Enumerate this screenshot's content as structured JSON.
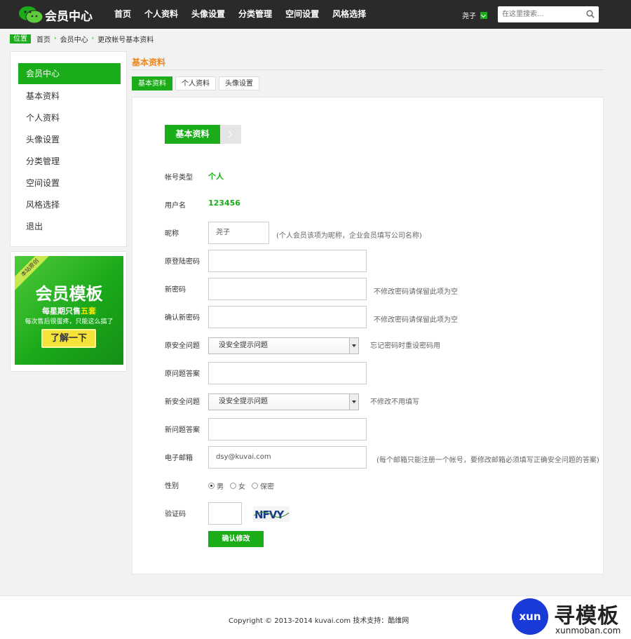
{
  "header": {
    "logo_text": "会员中心",
    "nav": [
      "首页",
      "个人资料",
      "头像设置",
      "分类管理",
      "空间设置",
      "风格选择"
    ],
    "username": "尧子",
    "search_placeholder": "在这里搜索..."
  },
  "breadcrumb": {
    "label": "位置",
    "items": [
      "首页",
      "会员中心",
      "更改帐号基本资料"
    ]
  },
  "sidebar": {
    "items": [
      "会员中心",
      "基本资料",
      "个人资料",
      "头像设置",
      "分类管理",
      "空间设置",
      "风格选择",
      "退出"
    ],
    "active": 0
  },
  "ad": {
    "ribbon": "本站原创",
    "title": "会员模板",
    "line1_prefix": "每星期只售",
    "line1_highlight": "五套",
    "line2": "每次售后很蛋疼，只能这么搞了",
    "button": "了解一下"
  },
  "main": {
    "section_title": "基本资料",
    "tabs": [
      "基本资料",
      "个人资料",
      "头像设置"
    ],
    "panel_title": "基本资料",
    "form": {
      "account_type_label": "帐号类型",
      "account_type_value": "个人",
      "username_label": "用户名",
      "username_value": "123456",
      "nickname_label": "昵称",
      "nickname_value": "尧子",
      "nickname_hint": "(个人会员该项为昵称，企业会员填写公司名称)",
      "old_password_label": "原登陆密码",
      "new_password_label": "新密码",
      "new_password_hint": "不修改密码请保留此项为空",
      "confirm_password_label": "确认新密码",
      "confirm_password_hint": "不修改密码请保留此项为空",
      "old_question_label": "原安全问题",
      "old_question_value": "没安全提示问题",
      "old_question_hint": "忘记密码时重设密码用",
      "old_answer_label": "原问题答案",
      "new_question_label": "新安全问题",
      "new_question_value": "没安全提示问题",
      "new_question_hint": "不修改不用填写",
      "new_answer_label": "新问题答案",
      "email_label": "电子邮箱",
      "email_value": "dsy@kuvai.com",
      "email_hint": "(每个邮箱只能注册一个帐号，要修改邮箱必须填写正确安全问题的答案)",
      "gender_label": "性别",
      "gender_options": [
        "男",
        "女",
        "保密"
      ],
      "gender_selected": 0,
      "captcha_label": "验证码",
      "captcha_text": "NFVY",
      "submit": "确认修改"
    }
  },
  "footer": {
    "copyright": "Copyright © 2013-2014 kuvai.com 技术支持：酷维网"
  },
  "watermark": {
    "circle": "xun",
    "cn": "寻模板",
    "en": "xunmoban.com"
  },
  "colors": {
    "brand_green": "#1aad19",
    "accent_orange": "#f08519",
    "header_bg": "#2a2a2a"
  }
}
